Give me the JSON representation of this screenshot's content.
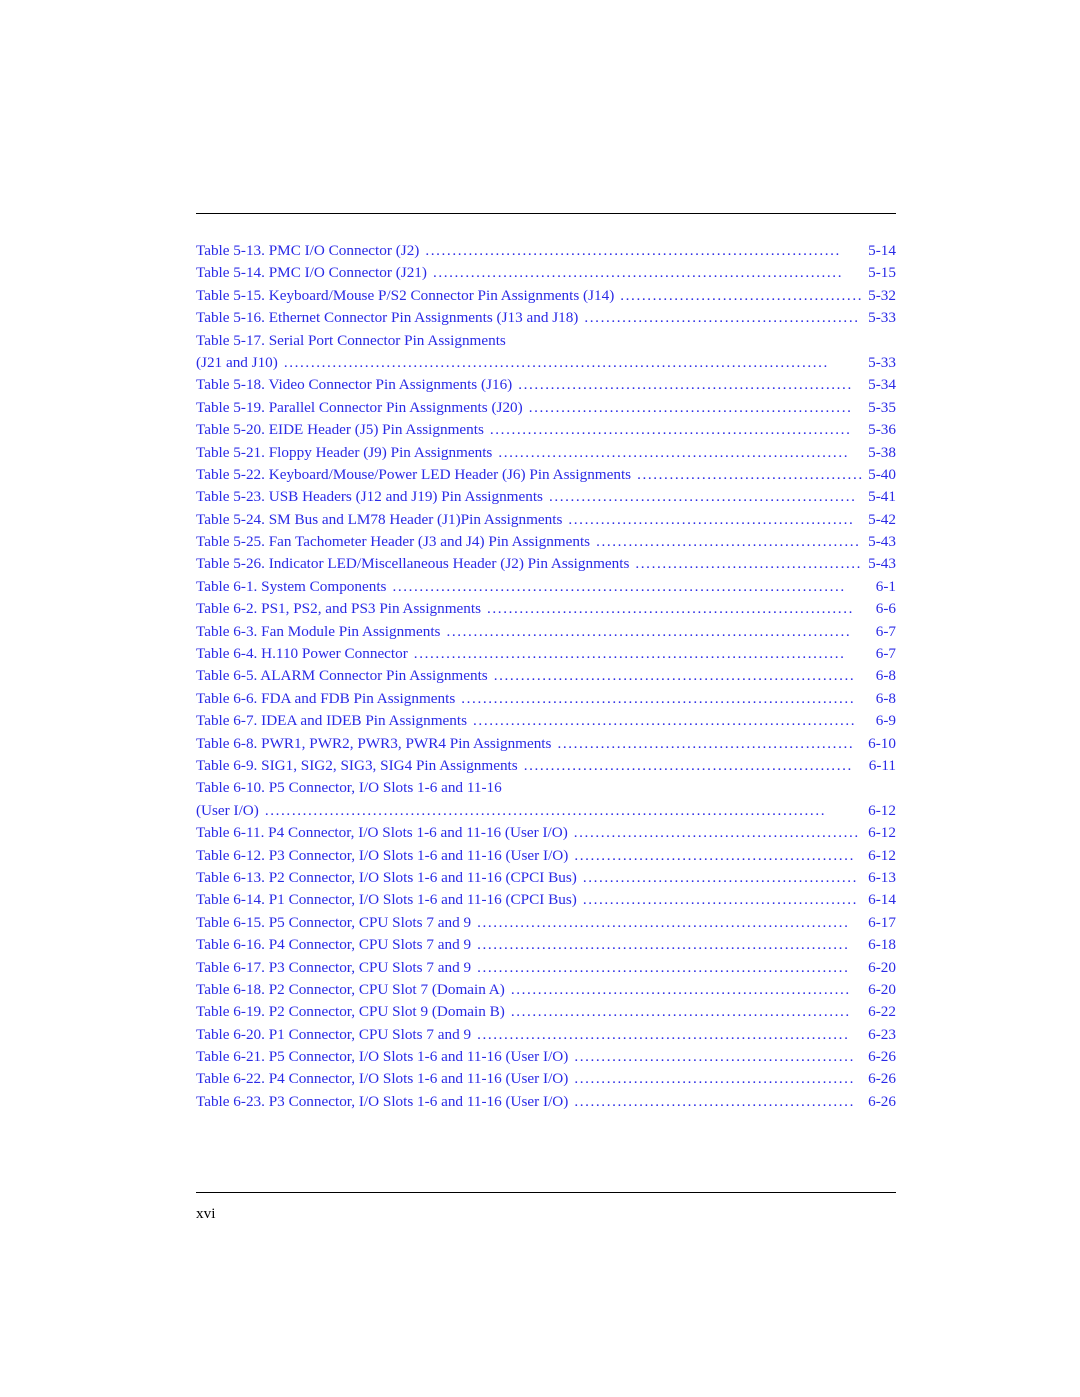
{
  "document": {
    "folio": "xvi",
    "toc_entries": [
      {
        "label": "Table 5-13.  PMC I/O Connector (J2)",
        "page": "5-14",
        "dots": true
      },
      {
        "label": "Table 5-14.  PMC I/O Connector (J21)",
        "page": "5-15",
        "dots": true
      },
      {
        "label": "Table 5-15.  Keyboard/Mouse P/S2 Connector Pin Assignments (J14)",
        "page": "5-32",
        "dots": true
      },
      {
        "label": "Table 5-16.  Ethernet Connector Pin Assignments (J13 and J18)",
        "page": "5-33",
        "dots": true
      },
      {
        "label": "Table 5-17.  Serial Port Connector Pin Assignments",
        "page": "",
        "dots": false
      },
      {
        "label": "(J21 and J10)",
        "page": "5-33",
        "dots": true
      },
      {
        "label": "Table 5-18.  Video Connector Pin Assignments (J16)",
        "page": "5-34",
        "dots": true
      },
      {
        "label": "Table 5-19.  Parallel Connector Pin Assignments (J20)",
        "page": "5-35",
        "dots": true
      },
      {
        "label": "Table 5-20.  EIDE Header (J5) Pin Assignments",
        "page": "5-36",
        "dots": true
      },
      {
        "label": "Table 5-21.  Floppy Header (J9) Pin Assignments",
        "page": "5-38",
        "dots": true
      },
      {
        "label": "Table 5-22.  Keyboard/Mouse/Power LED Header (J6) Pin Assignments",
        "page": "5-40",
        "dots": true
      },
      {
        "label": "Table 5-23.  USB Headers (J12 and J19) Pin Assignments",
        "page": "5-41",
        "dots": true
      },
      {
        "label": "Table 5-24.  SM Bus and LM78 Header (J1)Pin Assignments",
        "page": "5-42",
        "dots": true
      },
      {
        "label": "Table 5-25.  Fan Tachometer Header (J3 and J4) Pin Assignments",
        "page": "5-43",
        "dots": true
      },
      {
        "label": "Table 5-26.  Indicator LED/Miscellaneous Header (J2) Pin Assignments",
        "page": "5-43",
        "dots": true
      },
      {
        "label": "Table 6-1.  System Components",
        "page": "6-1",
        "dots": true
      },
      {
        "label": "Table 6-2.  PS1, PS2, and PS3 Pin Assignments",
        "page": "6-6",
        "dots": true
      },
      {
        "label": "Table 6-3.   Fan Module Pin Assignments",
        "page": "6-7",
        "dots": true
      },
      {
        "label": "Table 6-4.  H.110 Power Connector",
        "page": "6-7",
        "dots": true
      },
      {
        "label": "Table 6-5.  ALARM Connector Pin Assignments",
        "page": "6-8",
        "dots": true
      },
      {
        "label": "Table 6-6.  FDA and FDB Pin Assignments",
        "page": "6-8",
        "dots": true
      },
      {
        "label": "Table 6-7.  IDEA and IDEB Pin Assignments",
        "page": "6-9",
        "dots": true
      },
      {
        "label": "Table 6-8.  PWR1, PWR2, PWR3, PWR4 Pin Assignments",
        "page": "6-10",
        "dots": true
      },
      {
        "label": "Table 6-9.  SIG1, SIG2, SIG3, SIG4 Pin Assignments",
        "page": "6-11",
        "dots": true
      },
      {
        "label": "Table 6-10.  P5 Connector, I/O Slots 1-6 and 11-16",
        "page": "",
        "dots": false
      },
      {
        "label": "(User I/O)",
        "page": "6-12",
        "dots": true
      },
      {
        "label": "Table 6-11.  P4 Connector, I/O Slots 1-6 and 11-16 (User I/O)",
        "page": "6-12",
        "dots": true
      },
      {
        "label": "Table 6-12.  P3 Connector, I/O Slots 1-6 and 11-16 (User I/O)",
        "page": "6-12",
        "dots": true
      },
      {
        "label": "Table 6-13.  P2 Connector, I/O Slots 1-6 and 11-16 (CPCI Bus)",
        "page": "6-13",
        "dots": true
      },
      {
        "label": "Table 6-14.  P1 Connector, I/O Slots 1-6 and 11-16 (CPCI Bus)",
        "page": "6-14",
        "dots": true
      },
      {
        "label": "Table 6-15.  P5 Connector, CPU Slots 7 and 9",
        "page": "6-17",
        "dots": true
      },
      {
        "label": "Table 6-16.  P4 Connector, CPU Slots 7 and 9",
        "page": "6-18",
        "dots": true
      },
      {
        "label": "Table 6-17.  P3 Connector, CPU Slots 7 and 9",
        "page": "6-20",
        "dots": true
      },
      {
        "label": "Table 6-18.  P2 Connector, CPU Slot 7 (Domain A)",
        "page": "6-20",
        "dots": true
      },
      {
        "label": "Table 6-19.  P2 Connector, CPU Slot 9 (Domain B)",
        "page": "6-22",
        "dots": true
      },
      {
        "label": "Table 6-20.  P1 Connector, CPU Slots 7 and 9",
        "page": "6-23",
        "dots": true
      },
      {
        "label": "Table 6-21.  P5 Connector, I/O Slots 1-6 and 11-16 (User I/O)",
        "page": "6-26",
        "dots": true
      },
      {
        "label": "Table 6-22.  P4 Connector, I/O Slots 1-6 and 11-16 (User I/O)",
        "page": "6-26",
        "dots": true
      },
      {
        "label": "Table 6-23.  P3 Connector, I/O Slots 1-6 and 11-16 (User I/O)",
        "page": "6-26",
        "dots": true
      }
    ]
  },
  "colors": {
    "link": "#2a2ae6",
    "text": "#000000",
    "background": "#ffffff"
  }
}
